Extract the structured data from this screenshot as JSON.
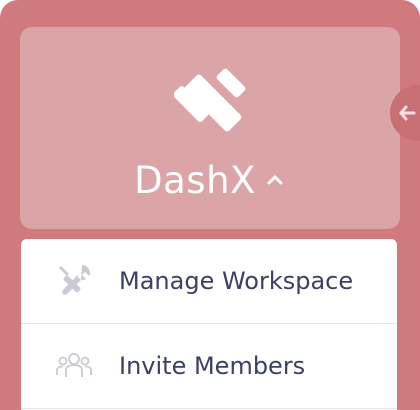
{
  "colors": {
    "sidebar_bg": "#d07a7e",
    "card_bg": "#dba5a7",
    "menu_text": "#3b4064",
    "icon_gray": "#c9cad6"
  },
  "workspace": {
    "name": "DashX",
    "logo_icon": "dashx-logo-icon",
    "toggle_icon": "chevron-up-icon"
  },
  "collapse_handle": {
    "icon": "arrow-left-icon"
  },
  "menu": {
    "items": [
      {
        "label": "Manage Workspace",
        "icon": "tools-icon"
      },
      {
        "label": "Invite Members",
        "icon": "members-icon"
      }
    ]
  }
}
